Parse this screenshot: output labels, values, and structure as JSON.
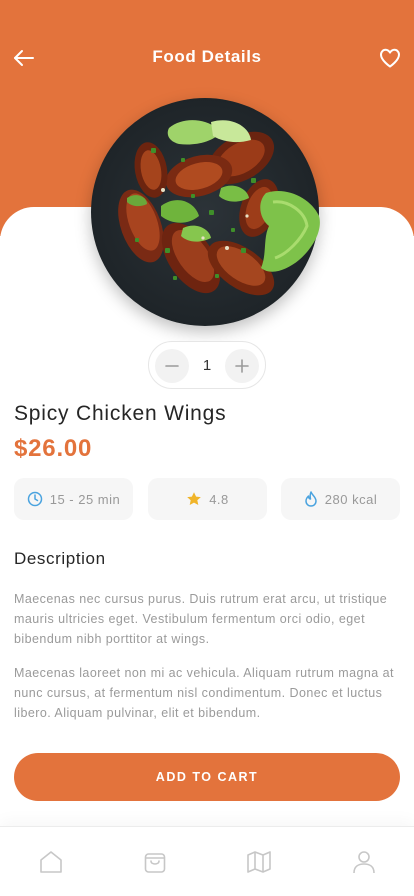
{
  "header": {
    "title": "Food Details",
    "back_icon": "arrow-left-icon",
    "favorite_icon": "heart-icon",
    "background_color": "#E3733C"
  },
  "food": {
    "image": "chicken-wings-plate",
    "name": "Spicy Chicken Wings",
    "price": "$26.00",
    "accent_color": "#E3733C"
  },
  "quantity": {
    "value": "1",
    "minus_icon": "minus-icon",
    "plus_icon": "plus-icon"
  },
  "stats": {
    "time": {
      "icon": "clock-icon",
      "label": "15 - 25 min",
      "icon_color": "#4aa3df"
    },
    "rating": {
      "icon": "star-icon",
      "label": "4.8",
      "icon_color": "#f0b429"
    },
    "calories": {
      "icon": "flame-icon",
      "label": "280 kcal",
      "icon_color": "#4aa3df"
    }
  },
  "description": {
    "title": "Description",
    "paragraph1": "Maecenas nec cursus purus. Duis rutrum erat arcu, ut tristique mauris ultricies eget. Vestibulum fermentum orci odio, eget bibendum nibh porttitor at wings.",
    "paragraph2": "Maecenas laoreet non mi ac vehicula. Aliquam rutrum magna at nunc cursus, at fermentum nisl condimentum. Donec et luctus libero. Aliquam pulvinar, elit et bibendum."
  },
  "actions": {
    "add_to_cart_label": "ADD TO CART"
  },
  "bottom_nav": {
    "items": [
      {
        "icon": "home-icon"
      },
      {
        "icon": "shopping-bag-icon"
      },
      {
        "icon": "map-icon"
      },
      {
        "icon": "user-icon"
      }
    ]
  }
}
